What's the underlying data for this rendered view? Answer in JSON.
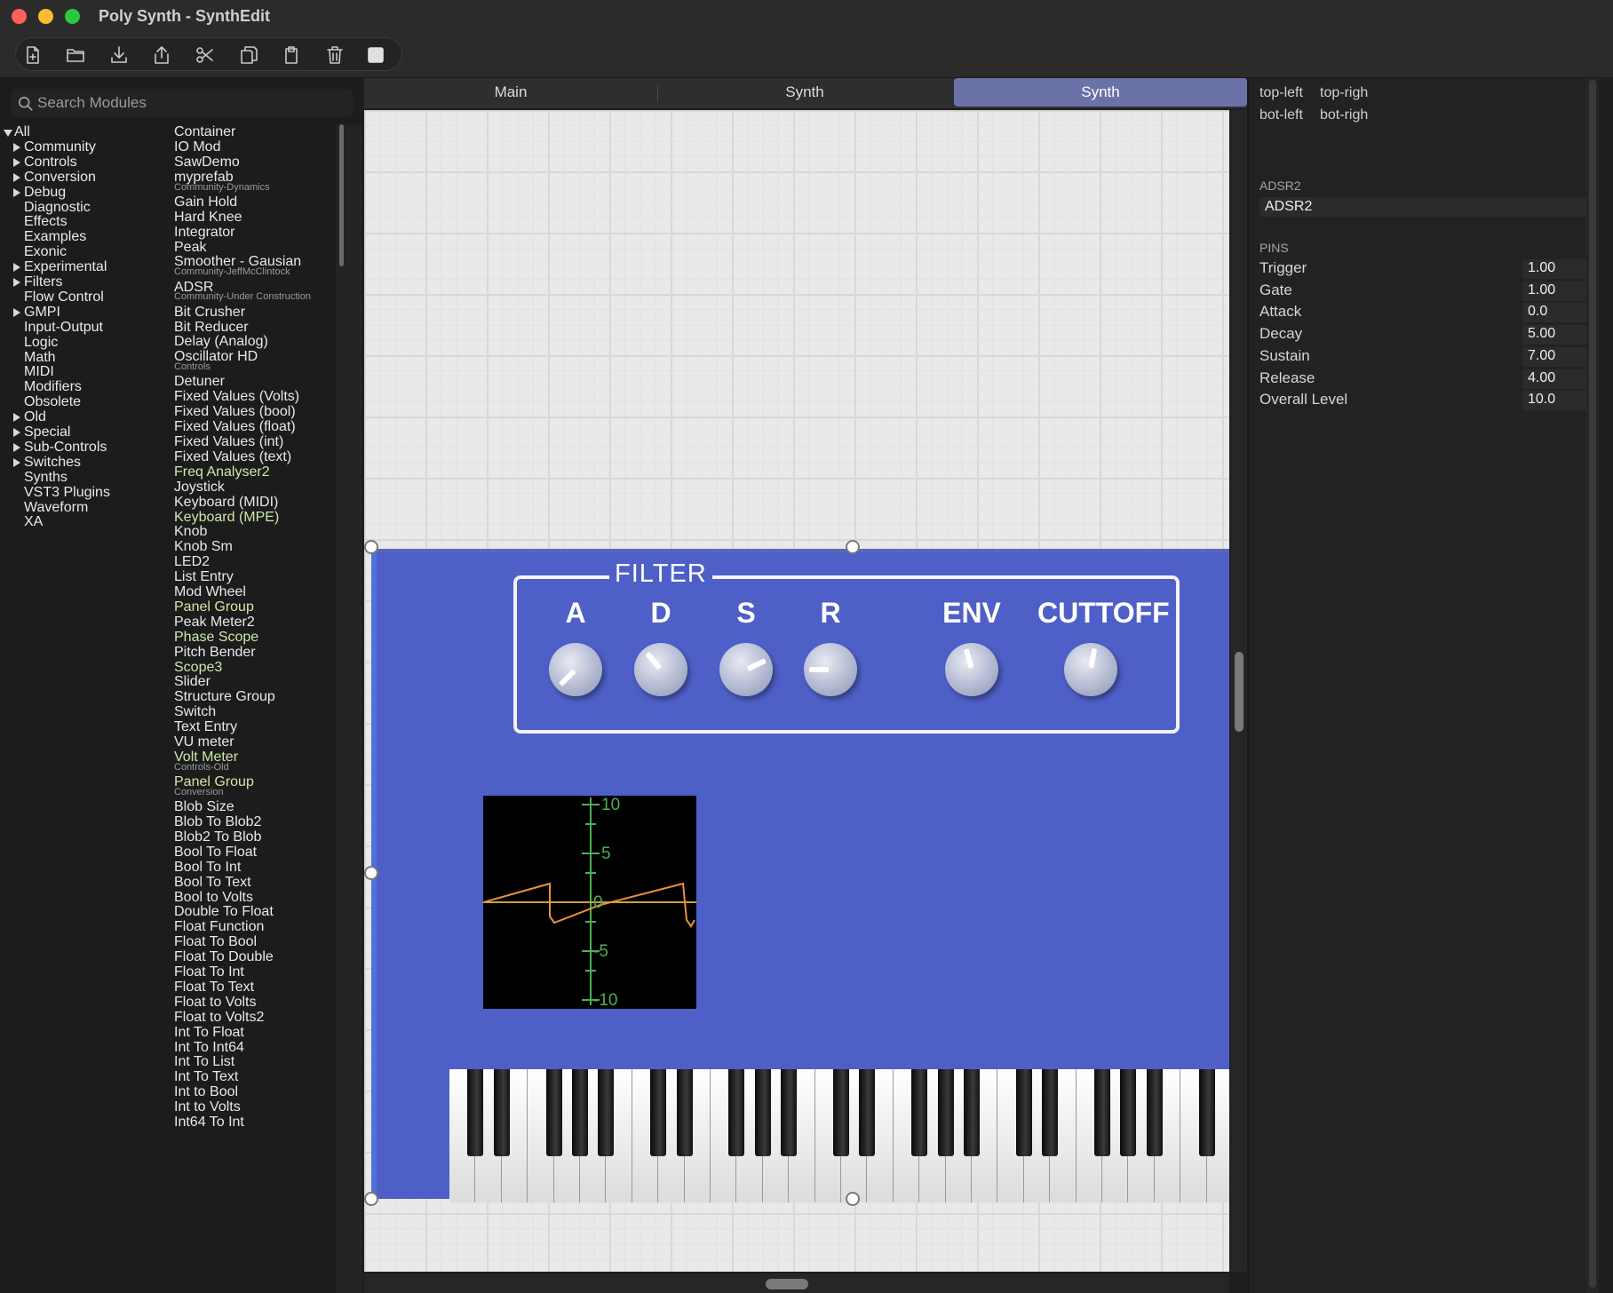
{
  "window": {
    "title": "Poly Synth - SynthEdit"
  },
  "toolbar": {
    "buttons": [
      {
        "icon": "new-file-icon"
      },
      {
        "icon": "open-folder-icon"
      },
      {
        "icon": "download-icon"
      },
      {
        "icon": "share-icon"
      },
      {
        "icon": "scissors-icon"
      },
      {
        "icon": "copy-icon"
      },
      {
        "icon": "paste-icon"
      },
      {
        "icon": "trash-icon"
      },
      {
        "icon": "stop-icon"
      }
    ]
  },
  "sidebar": {
    "search_placeholder": "Search Modules",
    "tree": [
      {
        "label": "All",
        "arrow": "down"
      },
      {
        "label": "Community",
        "arrow": "right"
      },
      {
        "label": "Controls",
        "arrow": "right"
      },
      {
        "label": "Conversion",
        "arrow": "right"
      },
      {
        "label": "Debug",
        "arrow": "right"
      },
      {
        "label": "Diagnostic",
        "arrow": ""
      },
      {
        "label": "Effects",
        "arrow": ""
      },
      {
        "label": "Examples",
        "arrow": ""
      },
      {
        "label": "Exonic",
        "arrow": ""
      },
      {
        "label": "Experimental",
        "arrow": "right"
      },
      {
        "label": "Filters",
        "arrow": "right"
      },
      {
        "label": "Flow Control",
        "arrow": ""
      },
      {
        "label": "GMPI",
        "arrow": "right"
      },
      {
        "label": "Input-Output",
        "arrow": ""
      },
      {
        "label": "Logic",
        "arrow": ""
      },
      {
        "label": "Math",
        "arrow": ""
      },
      {
        "label": "MIDI",
        "arrow": ""
      },
      {
        "label": "Modifiers",
        "arrow": ""
      },
      {
        "label": "Obsolete",
        "arrow": ""
      },
      {
        "label": "Old",
        "arrow": "right"
      },
      {
        "label": "Special",
        "arrow": "right"
      },
      {
        "label": "Sub-Controls",
        "arrow": "right"
      },
      {
        "label": "Switches",
        "arrow": "right"
      },
      {
        "label": "Synths",
        "arrow": ""
      },
      {
        "label": "VST3 Plugins",
        "arrow": ""
      },
      {
        "label": "Waveform",
        "arrow": ""
      },
      {
        "label": "XA",
        "arrow": ""
      }
    ],
    "modules": [
      {
        "label": "Container",
        "kind": "item"
      },
      {
        "label": "IO Mod",
        "kind": "item"
      },
      {
        "label": "SawDemo",
        "kind": "item"
      },
      {
        "label": "myprefab",
        "kind": "item"
      },
      {
        "label": "Community-Dynamics",
        "kind": "header"
      },
      {
        "label": "Gain Hold",
        "kind": "item"
      },
      {
        "label": "Hard Knee",
        "kind": "item"
      },
      {
        "label": "Integrator",
        "kind": "item"
      },
      {
        "label": "Peak",
        "kind": "item"
      },
      {
        "label": "Smoother - Gausian",
        "kind": "item"
      },
      {
        "label": "Community-JeffMcClintock",
        "kind": "header"
      },
      {
        "label": "ADSR",
        "kind": "item"
      },
      {
        "label": "Community-Under Construction",
        "kind": "header"
      },
      {
        "label": "Bit Crusher",
        "kind": "item"
      },
      {
        "label": "Bit Reducer",
        "kind": "item"
      },
      {
        "label": "Delay (Analog)",
        "kind": "item"
      },
      {
        "label": "Oscillator HD",
        "kind": "item"
      },
      {
        "label": "Controls",
        "kind": "header"
      },
      {
        "label": "Detuner",
        "kind": "item"
      },
      {
        "label": "Fixed Values (Volts)",
        "kind": "item"
      },
      {
        "label": "Fixed Values (bool)",
        "kind": "item"
      },
      {
        "label": "Fixed Values (float)",
        "kind": "item"
      },
      {
        "label": "Fixed Values (int)",
        "kind": "item"
      },
      {
        "label": "Fixed Values (text)",
        "kind": "item"
      },
      {
        "label": "Freq Analyser2",
        "kind": "green"
      },
      {
        "label": "Joystick",
        "kind": "item"
      },
      {
        "label": "Keyboard (MIDI)",
        "kind": "item"
      },
      {
        "label": "Keyboard (MPE)",
        "kind": "green"
      },
      {
        "label": "Knob",
        "kind": "item"
      },
      {
        "label": "Knob Sm",
        "kind": "item"
      },
      {
        "label": "LED2",
        "kind": "item"
      },
      {
        "label": "List Entry",
        "kind": "item"
      },
      {
        "label": "Mod Wheel",
        "kind": "item"
      },
      {
        "label": "Panel Group",
        "kind": "green"
      },
      {
        "label": "Peak Meter2",
        "kind": "item"
      },
      {
        "label": "Phase Scope",
        "kind": "green"
      },
      {
        "label": "Pitch Bender",
        "kind": "item"
      },
      {
        "label": "Scope3",
        "kind": "green"
      },
      {
        "label": "Slider",
        "kind": "item"
      },
      {
        "label": "Structure Group",
        "kind": "item"
      },
      {
        "label": "Switch",
        "kind": "item"
      },
      {
        "label": "Text Entry",
        "kind": "item"
      },
      {
        "label": "VU meter",
        "kind": "item"
      },
      {
        "label": "Volt Meter",
        "kind": "green"
      },
      {
        "label": "Controls-Old",
        "kind": "header"
      },
      {
        "label": "Panel Group",
        "kind": "green"
      },
      {
        "label": "Conversion",
        "kind": "header"
      },
      {
        "label": "Blob Size",
        "kind": "item"
      },
      {
        "label": "Blob To Blob2",
        "kind": "item"
      },
      {
        "label": "Blob2 To Blob",
        "kind": "item"
      },
      {
        "label": "Bool To Float",
        "kind": "item"
      },
      {
        "label": "Bool To Int",
        "kind": "item"
      },
      {
        "label": "Bool To Text",
        "kind": "item"
      },
      {
        "label": "Bool to Volts",
        "kind": "item"
      },
      {
        "label": "Double To Float",
        "kind": "item"
      },
      {
        "label": "Float Function",
        "kind": "item"
      },
      {
        "label": "Float To Bool",
        "kind": "item"
      },
      {
        "label": "Float To Double",
        "kind": "item"
      },
      {
        "label": "Float To Int",
        "kind": "item"
      },
      {
        "label": "Float To Text",
        "kind": "item"
      },
      {
        "label": "Float to Volts",
        "kind": "item"
      },
      {
        "label": "Float to Volts2",
        "kind": "item"
      },
      {
        "label": "Int To Float",
        "kind": "item"
      },
      {
        "label": "Int To Int64",
        "kind": "item"
      },
      {
        "label": "Int To List",
        "kind": "item"
      },
      {
        "label": "Int To Text",
        "kind": "item"
      },
      {
        "label": "Int to Bool",
        "kind": "item"
      },
      {
        "label": "Int to Volts",
        "kind": "item"
      },
      {
        "label": "Int64 To Int",
        "kind": "item"
      }
    ]
  },
  "tabs": [
    {
      "label": "Main",
      "active": false
    },
    {
      "label": "Synth",
      "active": false
    },
    {
      "label": "Synth",
      "active": true
    }
  ],
  "panel": {
    "filter_title": "FILTER",
    "knobs": [
      {
        "label": "A",
        "angle_deg": -135
      },
      {
        "label": "D",
        "angle_deg": -40
      },
      {
        "label": "S",
        "angle_deg": 65
      },
      {
        "label": "R",
        "angle_deg": -90
      },
      {
        "label": "ENV",
        "angle_deg": -15
      },
      {
        "label": "CUTTOFF",
        "angle_deg": 10
      }
    ],
    "scope_labels": [
      "10",
      "5",
      "0",
      "-5",
      "-10"
    ],
    "colors": {
      "panel": "#4f5fc8",
      "scope_grid": "#4caf50",
      "scope_wave": "#e8903a"
    }
  },
  "properties": {
    "corner_labels": [
      "top-left",
      "top-righ",
      "bot-left",
      "bot-righ"
    ],
    "module_section": "ADSR2",
    "module_name": "ADSR2",
    "pins_section": "PINS",
    "pins": [
      {
        "name": "Trigger",
        "value": "1.00"
      },
      {
        "name": "Gate",
        "value": "1.00"
      },
      {
        "name": "Attack",
        "value": "0.0"
      },
      {
        "name": "Decay",
        "value": "5.00"
      },
      {
        "name": "Sustain",
        "value": "7.00"
      },
      {
        "name": "Release",
        "value": "4.00"
      },
      {
        "name": "Overall Level",
        "value": "10.0"
      }
    ]
  }
}
